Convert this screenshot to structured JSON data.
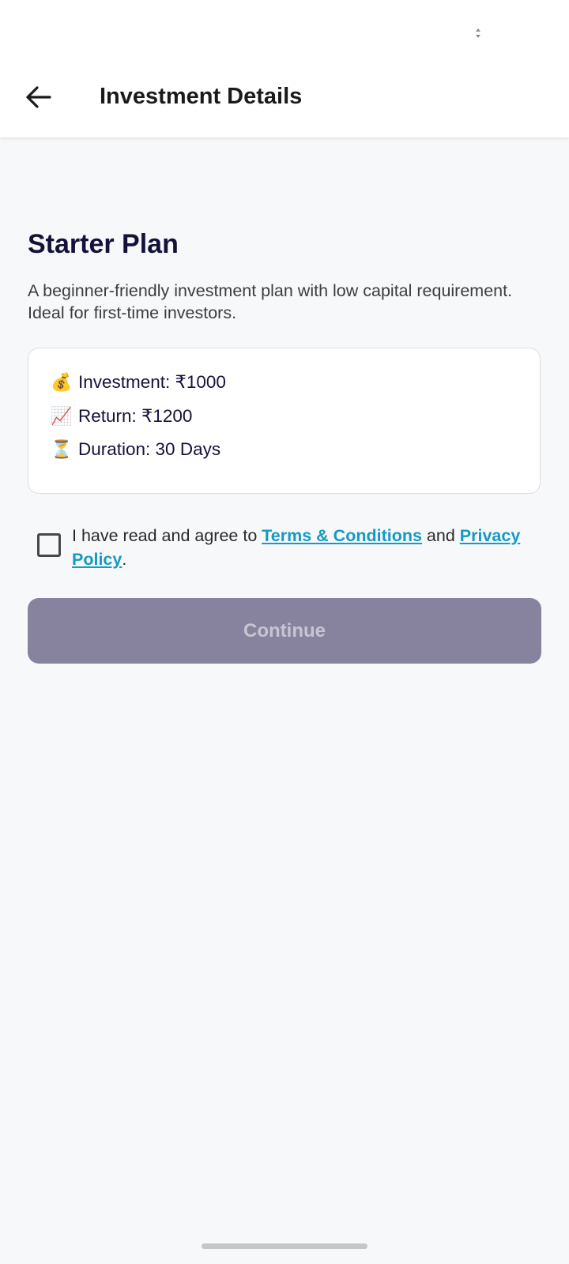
{
  "header": {
    "title": "Investment Details",
    "back_icon": "arrow-left-icon"
  },
  "plan": {
    "name": "Starter Plan",
    "description": "A beginner-friendly investment plan with low capital requirement. Ideal for first-time investors.",
    "details": [
      {
        "icon": "💰",
        "icon_name": "money-bag-icon",
        "text": "Investment: ₹1000"
      },
      {
        "icon": "📈",
        "icon_name": "chart-increasing-icon",
        "text": "Return: ₹1200"
      },
      {
        "icon": "⏳",
        "icon_name": "hourglass-icon",
        "text": "Duration: 30 Days"
      }
    ]
  },
  "agreement": {
    "checked": false,
    "prefix": "I have read and agree to ",
    "terms_link": "Terms & Conditions",
    "middle": " and ",
    "privacy_link": "Privacy Policy",
    "suffix": "."
  },
  "continue_button": {
    "label": "Continue",
    "enabled": false
  },
  "colors": {
    "title": "#141239",
    "link": "#149ac3",
    "button_disabled_bg": "#87839e",
    "button_disabled_text": "#c7c5d3",
    "background": "#f7f8fa"
  }
}
